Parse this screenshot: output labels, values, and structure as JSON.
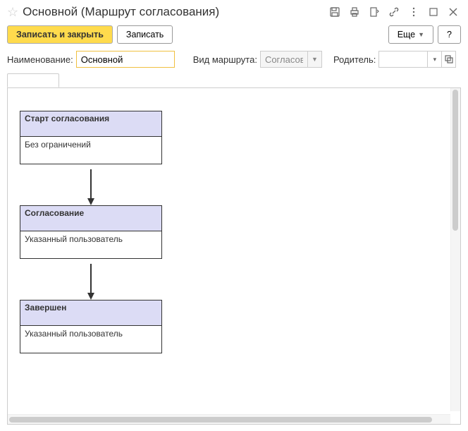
{
  "header": {
    "title": "Основной (Маршрут согласования)"
  },
  "toolbar": {
    "save_close": "Записать и закрыть",
    "save": "Записать",
    "more": "Еще",
    "help": "?"
  },
  "form": {
    "name_label": "Наименование:",
    "name_value": "Основной",
    "type_label": "Вид маршрута:",
    "type_value": "Согласова",
    "parent_label": "Родитель:",
    "parent_value": ""
  },
  "nodes": [
    {
      "title": "Старт согласования",
      "body": "Без ограничений"
    },
    {
      "title": "Согласование",
      "body": "Указанный пользователь"
    },
    {
      "title": "Завершен",
      "body": "Указанный пользователь"
    }
  ]
}
